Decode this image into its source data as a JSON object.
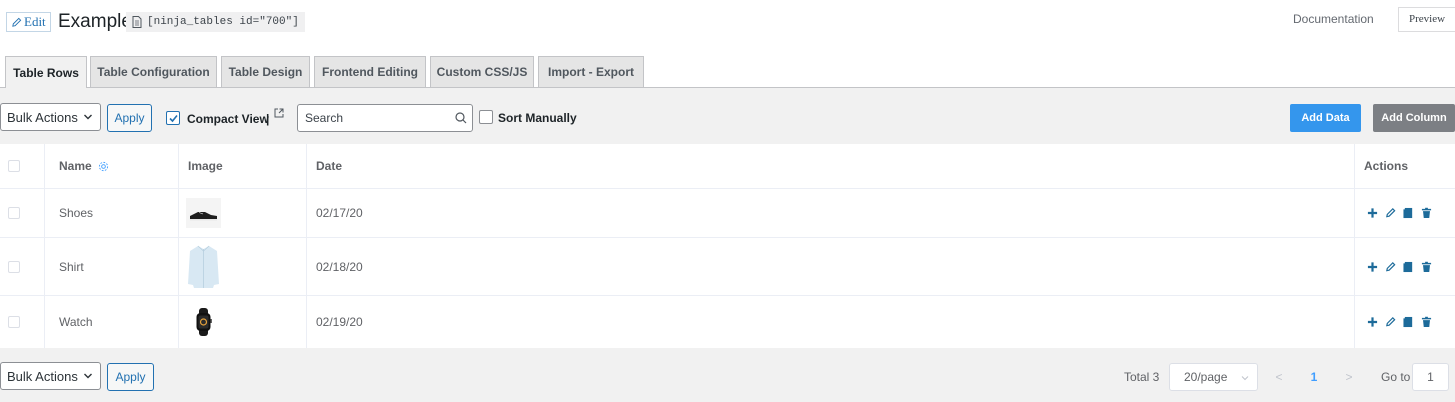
{
  "header": {
    "edit_label": "Edit",
    "title": "Example",
    "shortcode": "[ninja_tables id=\"700\"]",
    "documentation_label": "Documentation",
    "preview_label": "Preview"
  },
  "tabs": [
    {
      "label": "Table Rows",
      "active": true
    },
    {
      "label": "Table Configuration",
      "active": false
    },
    {
      "label": "Table Design",
      "active": false
    },
    {
      "label": "Frontend Editing",
      "active": false
    },
    {
      "label": "Custom CSS/JS",
      "active": false
    },
    {
      "label": "Import - Export",
      "active": false
    }
  ],
  "toolbar": {
    "bulk_actions_value": "Bulk Actions",
    "apply_label": "Apply",
    "compact_view_label": "Compact View",
    "compact_view_checked": true,
    "separator": "|",
    "search_placeholder": "Search",
    "sort_manually_label": "Sort Manually",
    "sort_manually_checked": false,
    "add_data_label": "Add Data",
    "add_column_label": "Add Column"
  },
  "table": {
    "headers": {
      "name": "Name",
      "image": "Image",
      "date": "Date",
      "actions": "Actions"
    },
    "rows": [
      {
        "name": "Shoes",
        "image_icon": "shoe-thumbnail",
        "date": "02/17/20"
      },
      {
        "name": "Shirt",
        "image_icon": "shirt-thumbnail",
        "date": "02/18/20"
      },
      {
        "name": "Watch",
        "image_icon": "watch-thumbnail",
        "date": "02/19/20"
      }
    ],
    "row_action_icons": [
      "plus-icon",
      "pencil-icon",
      "copy-icon",
      "trash-icon"
    ]
  },
  "footer": {
    "bulk_actions_value": "Bulk Actions",
    "apply_label": "Apply",
    "total_text": "Total 3",
    "page_size_value": "20/page",
    "current_page": "1",
    "goto_label": "Go to",
    "goto_value": "1"
  },
  "colors": {
    "link_blue": "#2271b1",
    "add_data_bg": "#3496ed",
    "add_column_bg": "#7c7f84",
    "action_icon": "#1d6b9a",
    "pager_active": "#409eff"
  }
}
